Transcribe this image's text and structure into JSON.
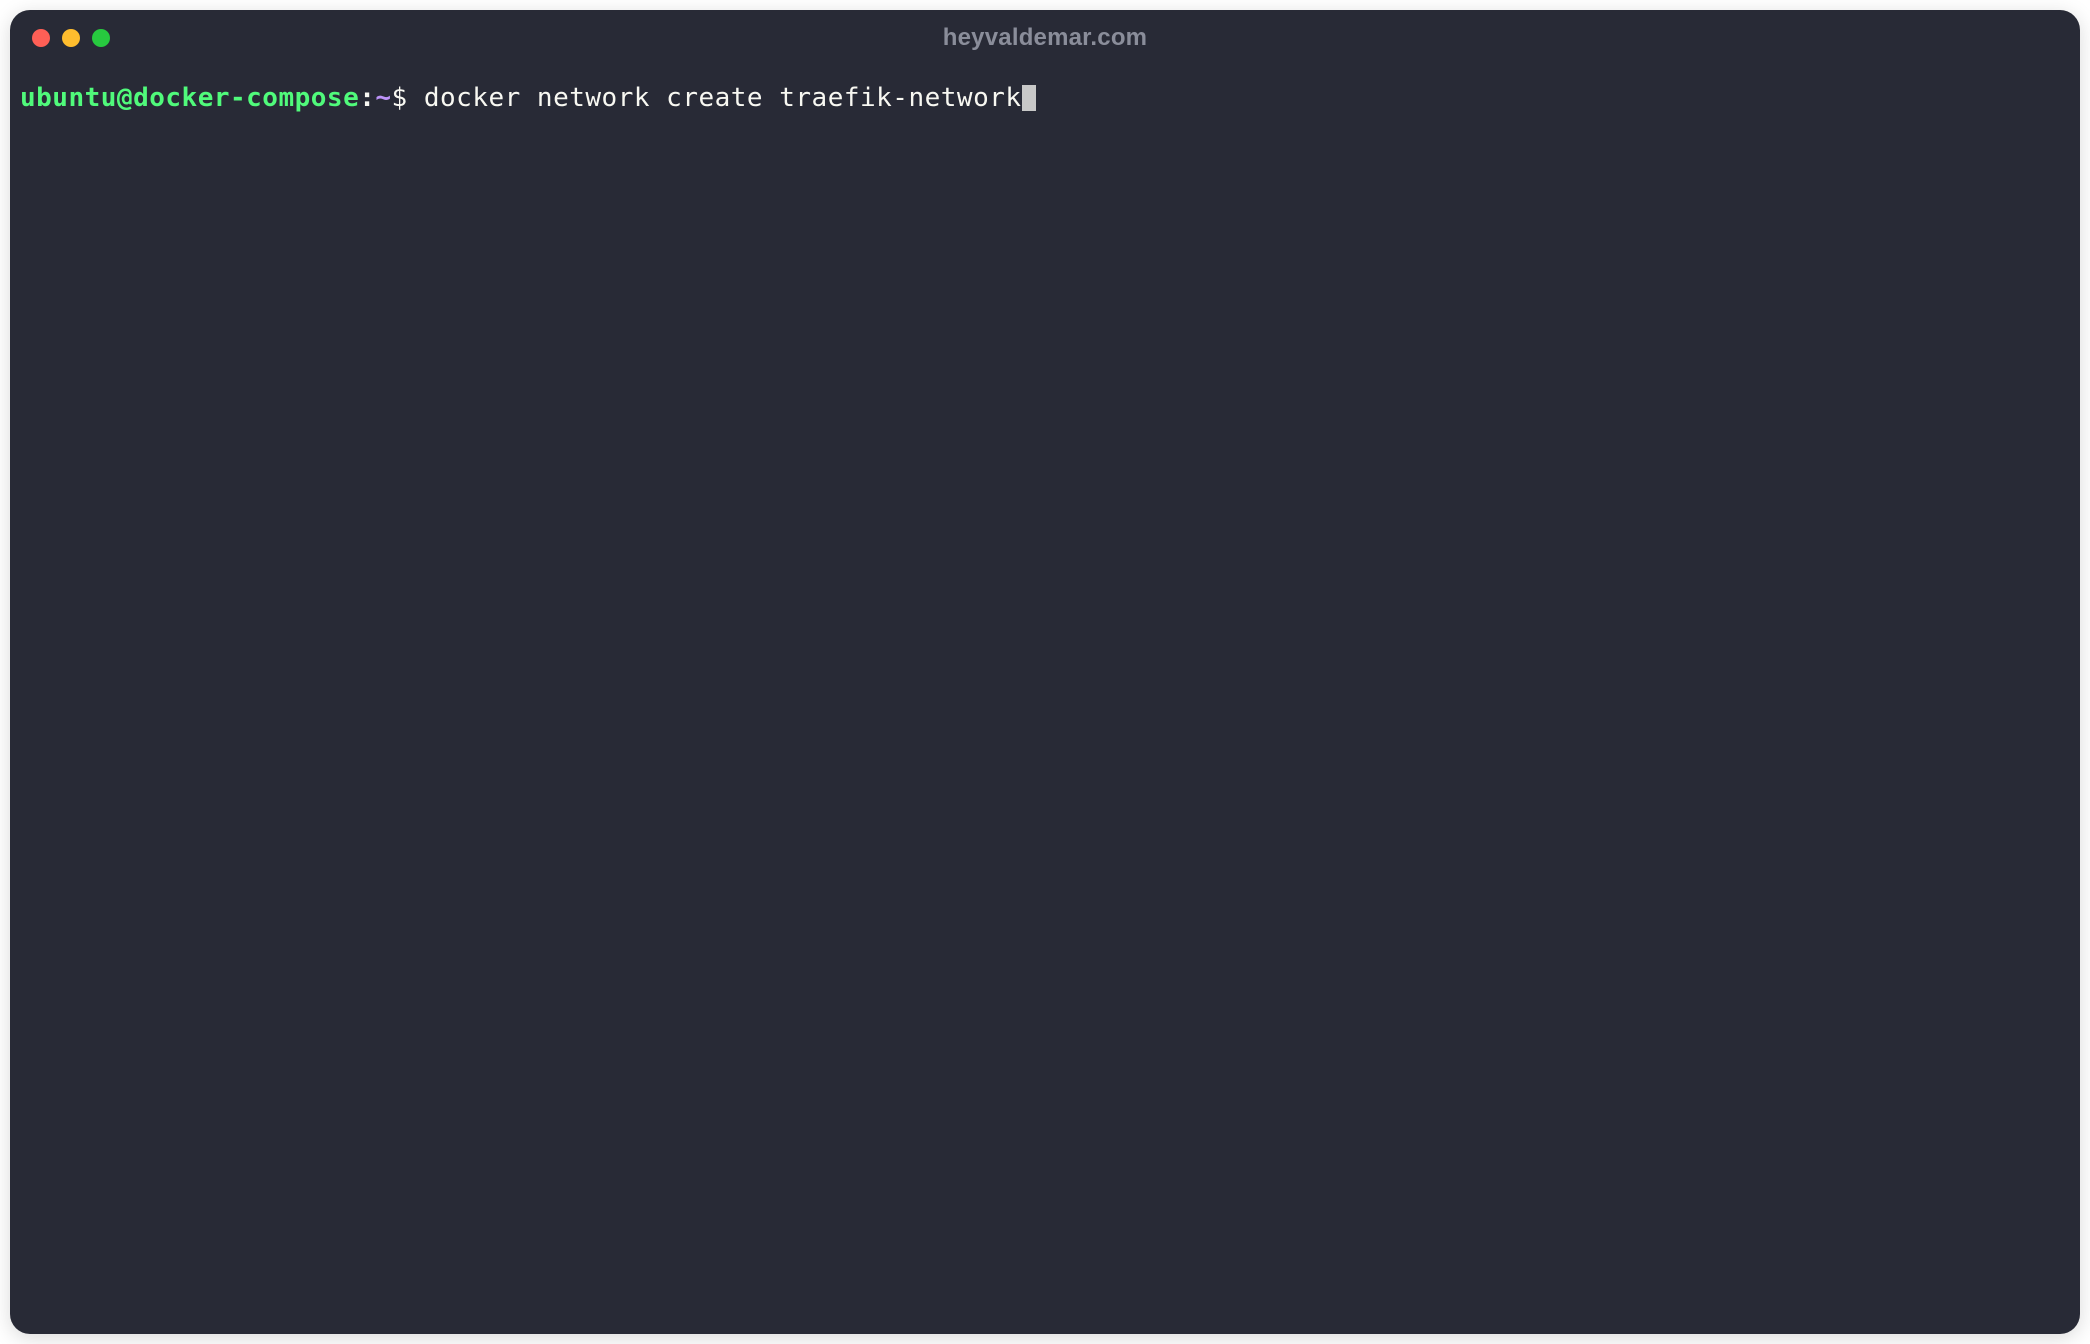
{
  "window": {
    "title": "heyvaldemar.com"
  },
  "traffic_lights": {
    "close_color": "#ff5f56",
    "minimize_color": "#ffbd2e",
    "maximize_color": "#27c93f"
  },
  "prompt": {
    "user": "ubuntu",
    "at": "@",
    "host": "docker-compose",
    "colon": ":",
    "path": "~",
    "symbol": "$ "
  },
  "command": "docker network create traefik-network"
}
